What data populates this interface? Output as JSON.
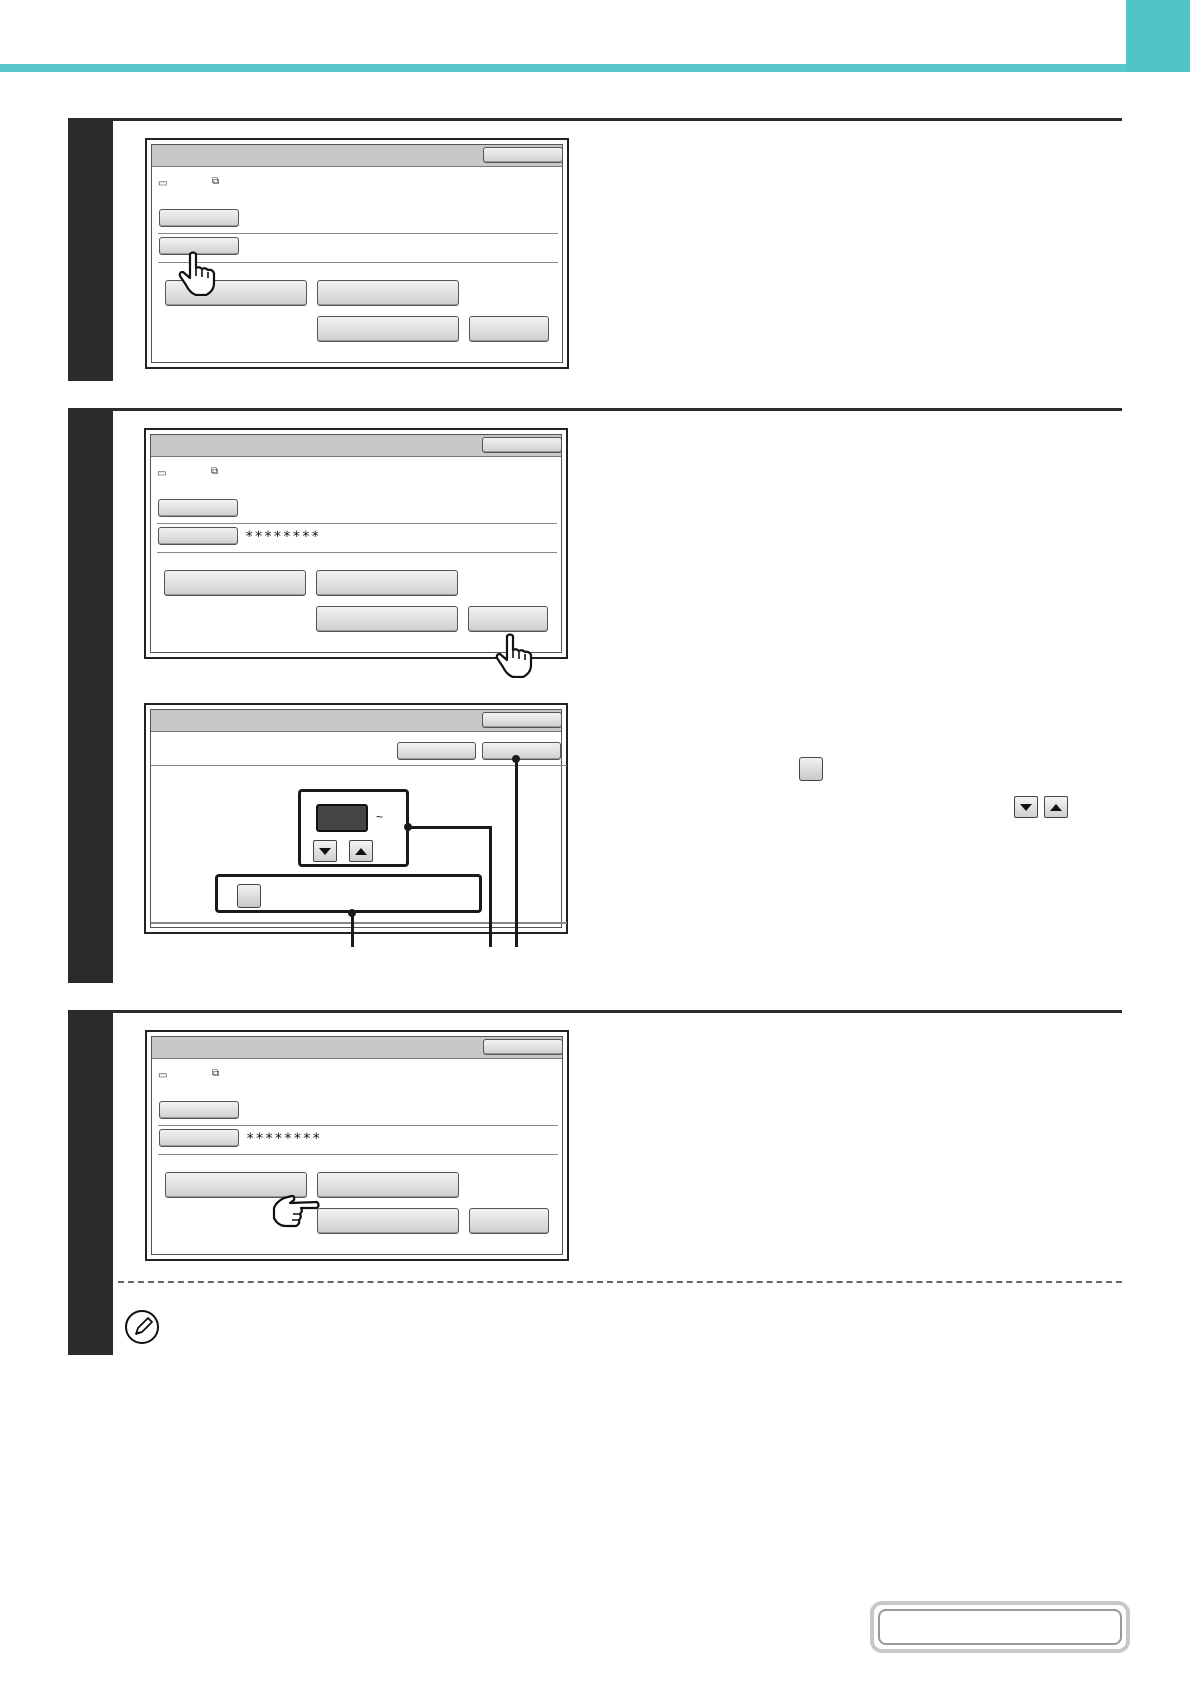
{
  "header": {
    "accent_color": "#59c8cc"
  },
  "screens": {
    "masked_password": "********",
    "tilde": "~"
  },
  "icons": {
    "folder": "folder-icon",
    "file": "file-icon",
    "hand_press": "hand-pointer-icon",
    "hand_point": "hand-pointing-icon",
    "note": "pencil-note-icon"
  }
}
